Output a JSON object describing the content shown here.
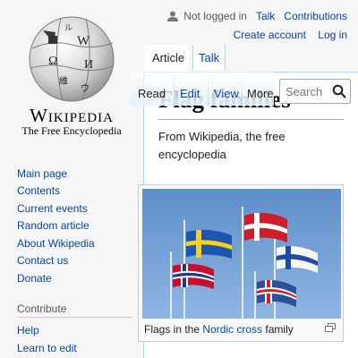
{
  "logo": {
    "wordmark": "Wikipedia",
    "tagline": "The Free Encyclopedia"
  },
  "personal_tools": {
    "not_logged_in": "Not logged in",
    "talk": "Talk",
    "contributions": "Contributions",
    "create_account": "Create account",
    "log_in": "Log in"
  },
  "namespace_tabs": {
    "article": "Article",
    "talk": "Talk"
  },
  "view_tabs": {
    "read": "Read",
    "edit": "Edit",
    "view_history": "View",
    "more": "More"
  },
  "search": {
    "placeholder": "Search"
  },
  "page": {
    "title": "Flag families",
    "from_wikipedia": "From Wikipedia, the free encyclopedia"
  },
  "thumbnail": {
    "caption_prefix": "Flags in the ",
    "caption_link": "Nordic cross",
    "caption_suffix": " family"
  },
  "sidebar": {
    "navigation": [
      "Main page",
      "Contents",
      "Current events",
      "Random article",
      "About Wikipedia",
      "Contact us",
      "Donate"
    ],
    "contribute_heading": "Contribute",
    "contribute": [
      "Help",
      "Learn to edit"
    ]
  },
  "colors": {
    "link": "#0645ad",
    "border": "#a7d7f9",
    "background": "#f6f6f6"
  }
}
